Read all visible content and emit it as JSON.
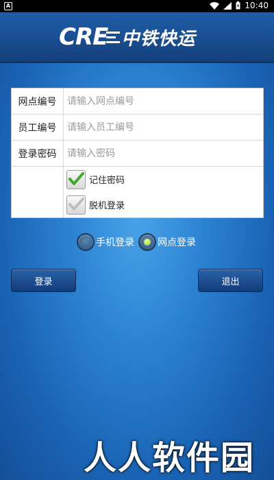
{
  "status_bar": {
    "time": "10:40",
    "left_icon": "A"
  },
  "header": {
    "logo_mark": "CRE",
    "logo_name": "中铁快运"
  },
  "form": {
    "rows": [
      {
        "label": "网点编号",
        "placeholder": "请输入网点编号",
        "value": ""
      },
      {
        "label": "员工编号",
        "placeholder": "请输入员工编号",
        "value": ""
      },
      {
        "label": "登录密码",
        "placeholder": "请输入密码",
        "value": ""
      }
    ],
    "checks": [
      {
        "label": "记住密码",
        "checked": true
      },
      {
        "label": "脱机登录",
        "checked": false
      }
    ]
  },
  "radios": [
    {
      "label": "手机登录",
      "selected": false
    },
    {
      "label": "网点登录",
      "selected": true
    }
  ],
  "buttons": {
    "login": "登录",
    "exit": "退出"
  },
  "watermark": "人人软件园",
  "colors": {
    "check_on": "#3fa82c",
    "check_off": "#bdbdbd",
    "radio_on": "#8bd22a"
  }
}
